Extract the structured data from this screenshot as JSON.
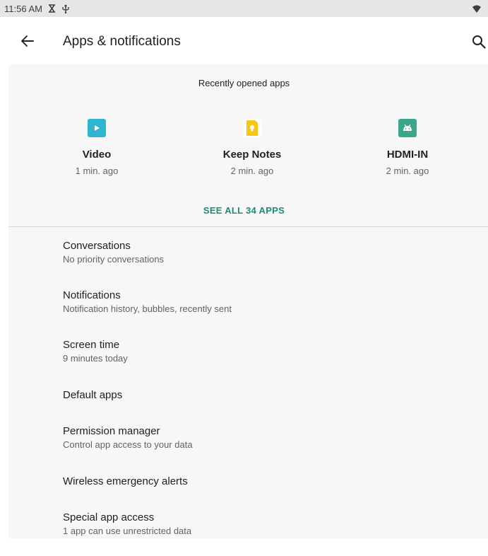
{
  "status_bar": {
    "time": "11:56 AM",
    "icons": [
      "hourglass-icon",
      "usb-icon",
      "wifi-icon"
    ]
  },
  "app_bar": {
    "title": "Apps & notifications",
    "back_icon": "arrow-left-icon",
    "search_icon": "search-icon"
  },
  "recent": {
    "header": "Recently opened apps",
    "apps": [
      {
        "name": "Video",
        "time": "1 min. ago",
        "icon": "video-play-icon",
        "color": "#2eb6d1"
      },
      {
        "name": "Keep Notes",
        "time": "2 min. ago",
        "icon": "keep-notes-icon",
        "color": "#f5c518"
      },
      {
        "name": "HDMI-IN",
        "time": "2 min. ago",
        "icon": "android-icon",
        "color": "#3aa68a"
      }
    ],
    "see_all": "SEE ALL 34 APPS"
  },
  "settings": [
    {
      "title": "Conversations",
      "summary": "No priority conversations"
    },
    {
      "title": "Notifications",
      "summary": "Notification history, bubbles, recently sent"
    },
    {
      "title": "Screen time",
      "summary": "9 minutes today"
    },
    {
      "title": "Default apps",
      "summary": ""
    },
    {
      "title": "Permission manager",
      "summary": "Control app access to your data"
    },
    {
      "title": "Wireless emergency alerts",
      "summary": ""
    },
    {
      "title": "Special app access",
      "summary": "1 app can use unrestricted data"
    }
  ],
  "colors": {
    "accent": "#188f78",
    "status_bar_bg": "#e6e6e6",
    "content_bg": "#f7f7f7"
  }
}
